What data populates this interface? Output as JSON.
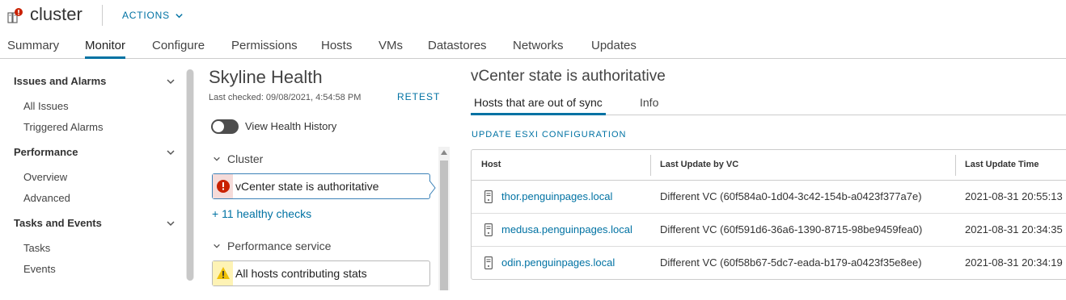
{
  "header": {
    "title": "cluster",
    "actions_label": "ACTIONS"
  },
  "tabs": [
    "Summary",
    "Monitor",
    "Configure",
    "Permissions",
    "Hosts",
    "VMs",
    "Datastores",
    "Networks",
    "Updates"
  ],
  "active_tab": "Monitor",
  "nav": {
    "groups": [
      {
        "label": "Issues and Alarms",
        "items": [
          "All Issues",
          "Triggered Alarms"
        ]
      },
      {
        "label": "Performance",
        "items": [
          "Overview",
          "Advanced"
        ]
      },
      {
        "label": "Tasks and Events",
        "items": [
          "Tasks",
          "Events"
        ]
      }
    ]
  },
  "skyline": {
    "title": "Skyline Health",
    "last_checked": "Last checked: 09/08/2021, 4:54:58 PM",
    "retest_label": "RETEST",
    "history_label": "View Health History",
    "groups": [
      {
        "label": "Cluster",
        "check": "vCenter state is authoritative",
        "status": "error",
        "healthy_link": "+ 11 healthy checks"
      },
      {
        "label": "Performance service",
        "check": "All hosts contributing stats",
        "status": "warning"
      }
    ]
  },
  "detail": {
    "title": "vCenter state is authoritative",
    "tabs": [
      "Hosts that are out of sync",
      "Info"
    ],
    "active_tab": "Hosts that are out of sync",
    "update_label": "UPDATE ESXI CONFIGURATION",
    "columns": [
      "Host",
      "Last Update by VC",
      "Last Update Time"
    ],
    "rows": [
      {
        "host": "thor.penguinpages.local",
        "last_update": "Different VC (60f584a0-1d04-3c42-154b-a0423f377a7e)",
        "time": "2021-08-31 20:55:13"
      },
      {
        "host": "medusa.penguinpages.local",
        "last_update": "Different VC (60f591d6-36a6-1390-8715-98be9459fea0)",
        "time": "2021-08-31 20:34:35"
      },
      {
        "host": "odin.penguinpages.local",
        "last_update": "Different VC (60f58b67-5dc7-eada-b179-a0423f35e8ee)",
        "time": "2021-08-31 20:34:19"
      }
    ]
  },
  "colors": {
    "accent": "#0072a3",
    "error": "#c92100",
    "warning": "#efc006"
  }
}
